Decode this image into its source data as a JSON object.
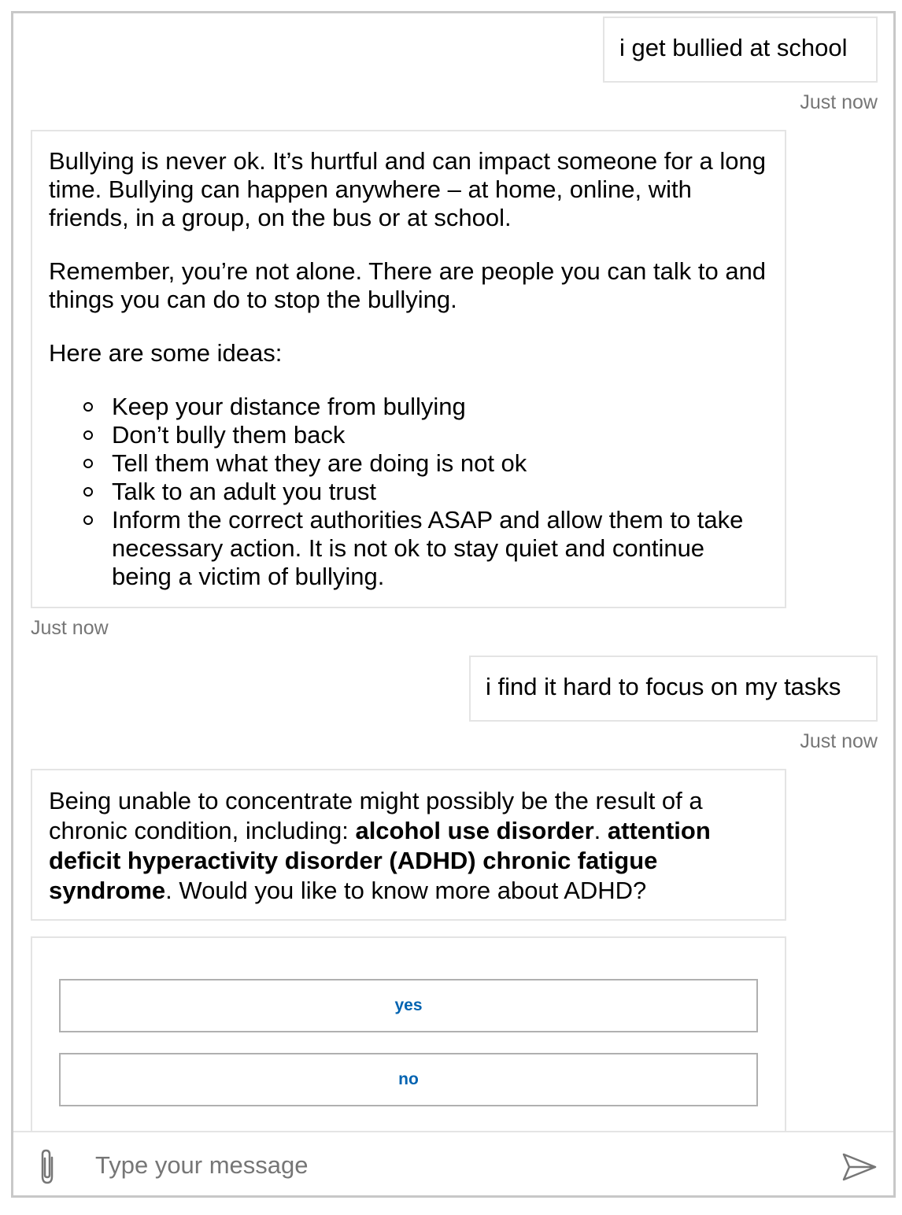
{
  "conversation": {
    "messages": [
      {
        "from": "user",
        "text": "i get bullied at school",
        "time": "Just now"
      },
      {
        "from": "bot",
        "paragraphs": [
          "Bullying is never ok. It’s hurtful and can impact someone for a long time. Bullying can happen anywhere – at home, online, with friends, in a group, on the bus or at school.",
          "Remember, you’re not alone. There are people you can talk to and things you can do to stop the bullying.",
          "Here are some ideas:"
        ],
        "list": [
          "Keep your distance from bullying",
          "Don’t bully them back",
          "Tell them what they are doing is not ok",
          "Talk to an adult you trust",
          "Inform the correct authorities ASAP and allow them to take necessary action. It is not ok to stay quiet and continue being a victim of bullying."
        ],
        "time": "Just now"
      },
      {
        "from": "user",
        "text": "i find it hard to focus on my tasks",
        "time": "Just now"
      },
      {
        "from": "bot",
        "segments": [
          {
            "text": "Being unable to concentrate might possibly be the result of a chronic condition, including: ",
            "bold": false
          },
          {
            "text": "alcohol use disorder",
            "bold": true
          },
          {
            "text": ". ",
            "bold": false
          },
          {
            "text": "attention deficit hyperactivity disorder (ADHD) chronic fatigue syndrome",
            "bold": true
          },
          {
            "text": ". Would you like to know more about ADHD?",
            "bold": false
          }
        ]
      }
    ],
    "suggested_actions": [
      "yes",
      "no"
    ]
  },
  "composer": {
    "placeholder": "Type your message",
    "value": "",
    "attach_icon": "paperclip-icon",
    "send_icon": "send-icon"
  },
  "colors": {
    "action_text": "#0063b1",
    "timestamp": "#767676",
    "bubble_border": "#e4e4e4",
    "frame_border": "#c8c8c8"
  }
}
